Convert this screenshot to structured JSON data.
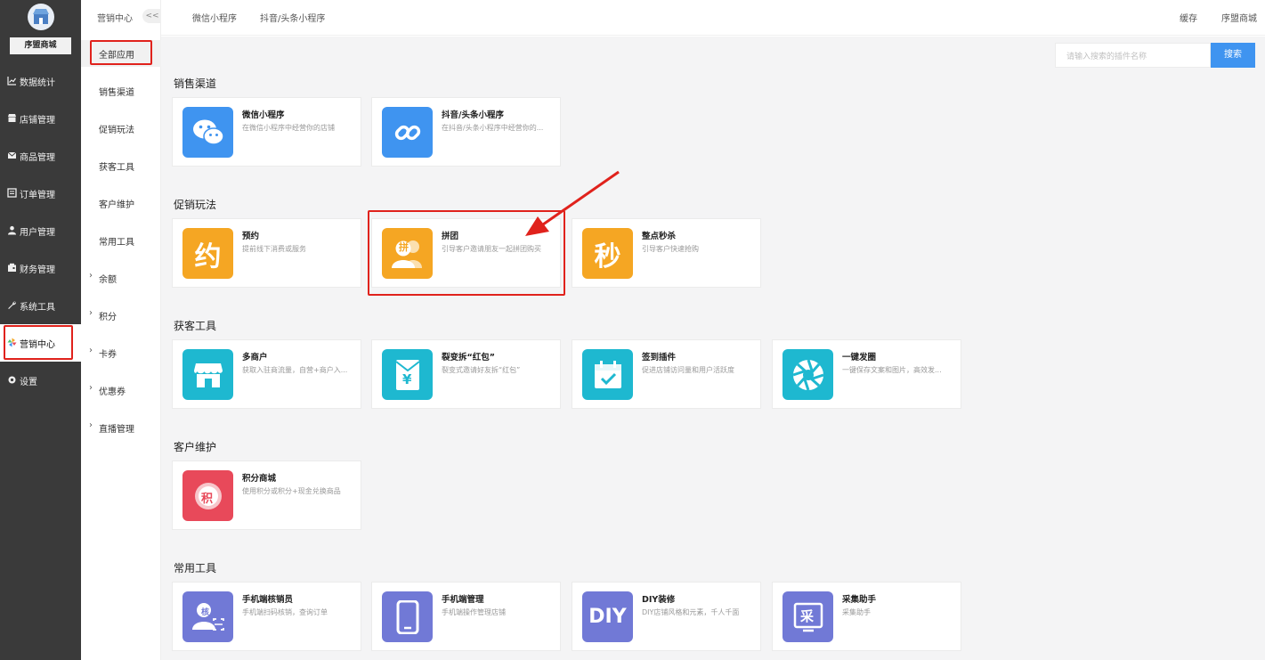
{
  "sidebar": {
    "brand_name": "序盟商城",
    "items": [
      {
        "label": "数据统计",
        "icon": "chart-line-icon"
      },
      {
        "label": "店铺管理",
        "icon": "shop-icon"
      },
      {
        "label": "商品管理",
        "icon": "mail-icon"
      },
      {
        "label": "订单管理",
        "icon": "list-icon"
      },
      {
        "label": "用户管理",
        "icon": "user-icon"
      },
      {
        "label": "财务管理",
        "icon": "wallet-icon"
      },
      {
        "label": "系统工具",
        "icon": "wrench-icon"
      },
      {
        "label": "营销中心",
        "icon": "pinwheel-icon",
        "active": true
      },
      {
        "label": "设置",
        "icon": "gear-icon"
      }
    ]
  },
  "subnav": {
    "title": "营销中心",
    "collapse_label": "<<",
    "items": [
      {
        "label": "全部应用",
        "active": true
      },
      {
        "label": "销售渠道"
      },
      {
        "label": "促销玩法"
      },
      {
        "label": "获客工具"
      },
      {
        "label": "客户维护"
      },
      {
        "label": "常用工具"
      },
      {
        "label": "余额",
        "expandable": true
      },
      {
        "label": "积分",
        "expandable": true
      },
      {
        "label": "卡券",
        "expandable": true
      },
      {
        "label": "优惠券",
        "expandable": true
      },
      {
        "label": "直播管理",
        "expandable": true
      }
    ]
  },
  "topbar": {
    "tabs": [
      "微信小程序",
      "抖音/头条小程序"
    ],
    "cache": "缓存",
    "shop": "序盟商城"
  },
  "search": {
    "placeholder": "请输入搜索的插件名称",
    "button": "搜索"
  },
  "sections": [
    {
      "title": "销售渠道",
      "cards": [
        {
          "name": "微信小程序",
          "desc": "在微信小程序中经营你的店铺",
          "icon": "wechat-icon",
          "color": "#3f94f0"
        },
        {
          "name": "抖音/头条小程序",
          "desc": "在抖音/头条小程序中经营你的...",
          "icon": "douyin-link-icon",
          "color": "#3f94f0"
        }
      ]
    },
    {
      "title": "促销玩法",
      "cards": [
        {
          "name": "预约",
          "desc": "提前线下消费或服务",
          "icon": "yue-icon",
          "glyph": "约",
          "color": "#f5a623"
        },
        {
          "name": "拼团",
          "desc": "引导客户邀请朋友一起拼团购买",
          "icon": "group-buy-icon",
          "glyph": "拼",
          "color": "#f5a623"
        },
        {
          "name": "整点秒杀",
          "desc": "引导客户快速抢购",
          "icon": "flash-sale-icon",
          "glyph": "秒",
          "color": "#f5a623"
        }
      ]
    },
    {
      "title": "获客工具",
      "cards": [
        {
          "name": "多商户",
          "desc": "获取入驻商流量，自营+商户入...",
          "icon": "storefront-icon",
          "color": "#1eb8d0"
        },
        {
          "name": "裂变拆“红包”",
          "desc": "裂变式邀请好友拆“红包”",
          "icon": "red-packet-icon",
          "glyph": "¥",
          "color": "#1eb8d0"
        },
        {
          "name": "签到插件",
          "desc": "促进店铺访问量和用户活跃度",
          "icon": "calendar-check-icon",
          "color": "#1eb8d0"
        },
        {
          "name": "一键发圈",
          "desc": "一键保存文案和图片，高效发...",
          "icon": "aperture-icon",
          "color": "#1eb8d0"
        }
      ]
    },
    {
      "title": "客户维护",
      "cards": [
        {
          "name": "积分商城",
          "desc": "使用积分或积分+现金兑换商品",
          "icon": "points-icon",
          "glyph": "积",
          "color": "#e8495a"
        }
      ]
    },
    {
      "title": "常用工具",
      "cards": [
        {
          "name": "手机端核销员",
          "desc": "手机端扫码核销，查询订单",
          "icon": "verifier-icon",
          "glyph": "核",
          "color": "#7179d6"
        },
        {
          "name": "手机端管理",
          "desc": "手机端操作管理店铺",
          "icon": "phone-icon",
          "color": "#7179d6"
        },
        {
          "name": "DIY装修",
          "desc": "DIY店铺风格和元素，千人千面",
          "icon": "diy-icon",
          "glyph": "DIY",
          "color": "#7179d6"
        },
        {
          "name": "采集助手",
          "desc": "采集助手",
          "icon": "collect-icon",
          "glyph": "采",
          "color": "#7179d6"
        }
      ]
    }
  ],
  "colors": {
    "sidebar_bg": "#3a3a3a",
    "accent_blue": "#3f94f0",
    "highlight_red": "#e0221c"
  }
}
